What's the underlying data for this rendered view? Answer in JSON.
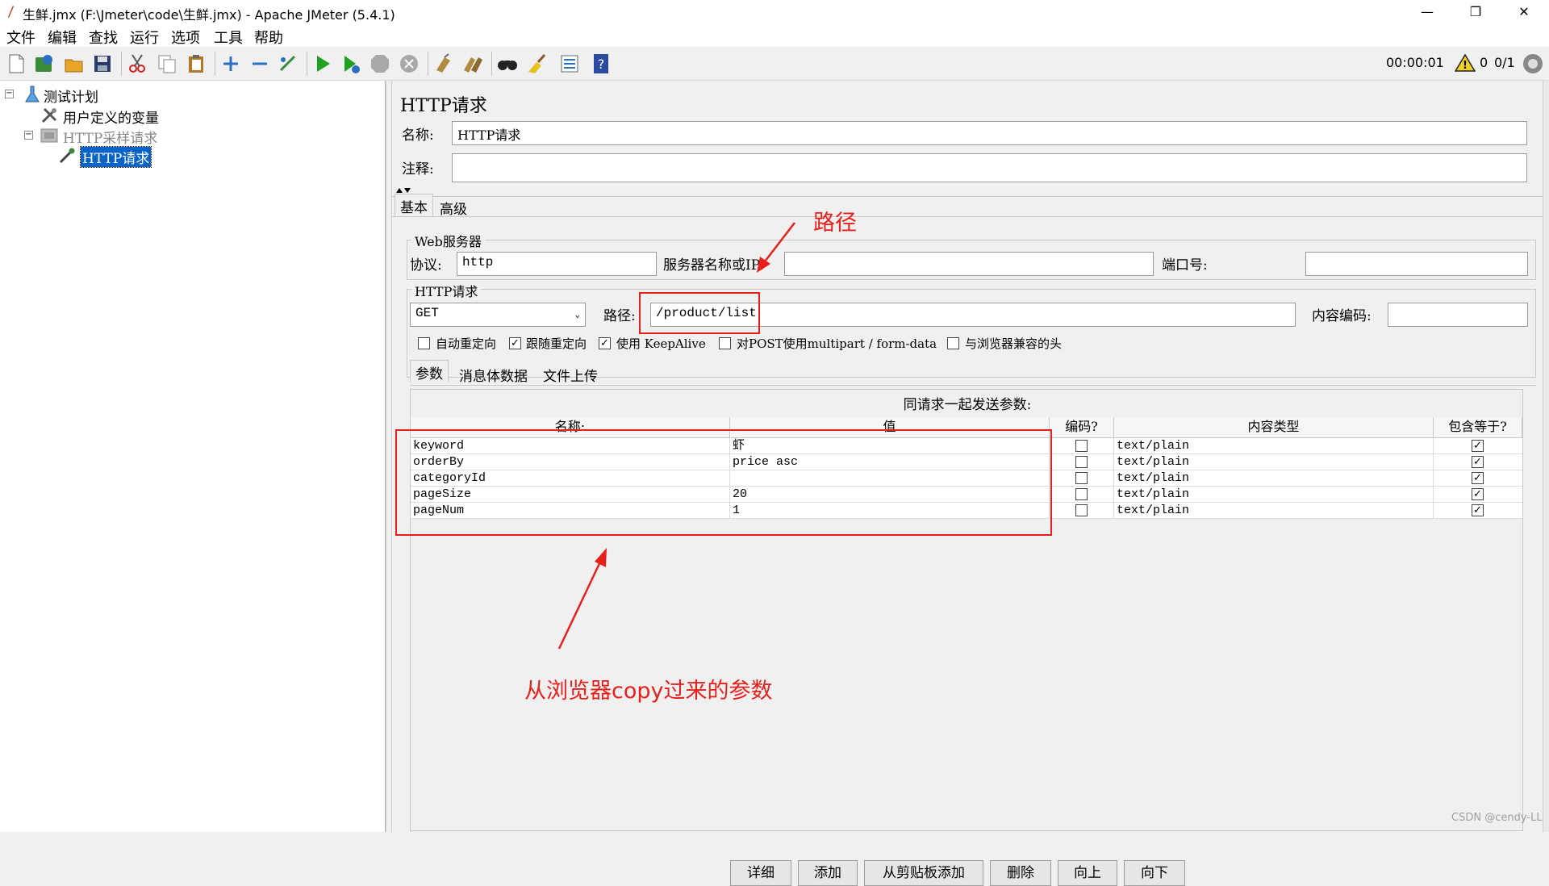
{
  "window": {
    "title": "生鲜.jmx (F:\\Jmeter\\code\\生鲜.jmx) - Apache JMeter (5.4.1)",
    "minimize": "—",
    "restore": "❐",
    "close": "✕"
  },
  "menu": [
    "文件",
    "编辑",
    "查找",
    "运行",
    "选项",
    "工具",
    "帮助"
  ],
  "toolbar": {
    "icons": [
      "new-icon",
      "templates-icon",
      "open-icon",
      "save-icon",
      "cut-icon",
      "copy-icon",
      "paste-icon",
      "expand-icon",
      "collapse-icon",
      "toggle-icon",
      "start-icon",
      "start-no-pause-icon",
      "stop-icon",
      "shutdown-icon",
      "clear-icon",
      "clear-all-icon",
      "search-icon",
      "reset-search-icon",
      "function-helper-icon",
      "help-icon"
    ],
    "timer": "00:00:01",
    "warning_count": "0",
    "threads": "0/1"
  },
  "tree": {
    "plan": "测试计划",
    "user_vars": "用户定义的变量",
    "thread_group": "HTTP采样请求",
    "sampler": "HTTP请求"
  },
  "panel": {
    "title": "HTTP请求",
    "name_label": "名称:",
    "name_value": "HTTP请求",
    "comment_label": "注释:",
    "comment_value": "",
    "tabs": [
      "基本",
      "高级"
    ],
    "web_server": {
      "group_title": "Web服务器",
      "protocol_label": "协议:",
      "protocol_value": "http",
      "server_label": "服务器名称或IP:",
      "server_value": "",
      "port_label": "端口号:",
      "port_value": ""
    },
    "http_request": {
      "group_title": "HTTP请求",
      "method": "GET",
      "path_label": "路径:",
      "path_value": "/product/list",
      "encoding_label": "内容编码:",
      "encoding_value": ""
    },
    "options": [
      {
        "label": "自动重定向",
        "checked": false
      },
      {
        "label": "跟随重定向",
        "checked": true
      },
      {
        "label": "使用 KeepAlive",
        "checked": true
      },
      {
        "label": "对POST使用multipart / form-data",
        "checked": false
      },
      {
        "label": "与浏览器兼容的头",
        "checked": false
      }
    ],
    "sub_tabs": [
      "参数",
      "消息体数据",
      "文件上传"
    ],
    "params_caption": "同请求一起发送参数:",
    "columns": [
      "名称:",
      "值",
      "编码?",
      "内容类型",
      "包含等于?"
    ],
    "rows": [
      {
        "name": "keyword",
        "value": "虾",
        "encode": false,
        "type": "text/plain",
        "include_equals": true
      },
      {
        "name": "orderBy",
        "value": "price asc",
        "encode": false,
        "type": "text/plain",
        "include_equals": true
      },
      {
        "name": "categoryId",
        "value": "",
        "encode": false,
        "type": "text/plain",
        "include_equals": true
      },
      {
        "name": "pageSize",
        "value": "20",
        "encode": false,
        "type": "text/plain",
        "include_equals": true
      },
      {
        "name": "pageNum",
        "value": "1",
        "encode": false,
        "type": "text/plain",
        "include_equals": true
      }
    ],
    "buttons": [
      "详细",
      "添加",
      "从剪贴板添加",
      "删除",
      "向上",
      "向下"
    ]
  },
  "annotations": {
    "path_note": "路径",
    "params_note": "从浏览器copy过来的参数"
  },
  "watermark": "CSDN @cendy-LL",
  "colors": {
    "annotation": "#e8201c",
    "selection": "#0a64c8"
  }
}
